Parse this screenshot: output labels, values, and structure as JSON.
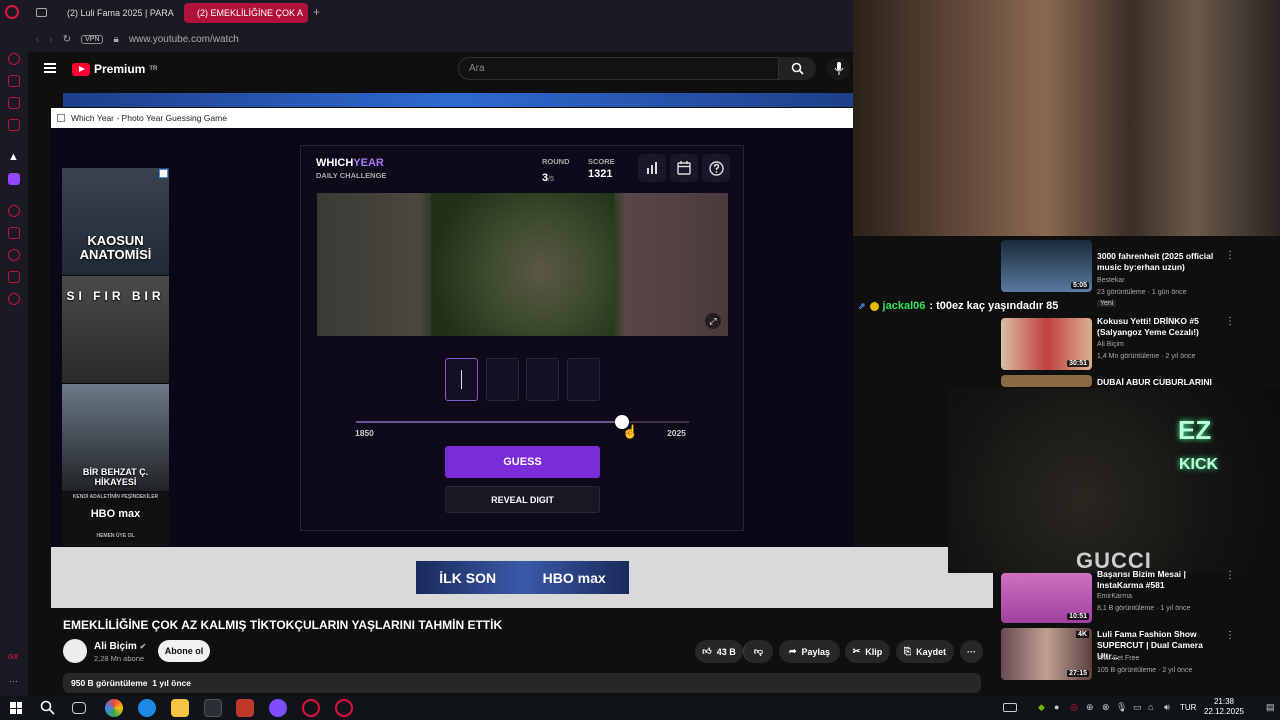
{
  "browser": {
    "tabs": [
      {
        "label": "(2) Luli Fama 2025 | PARA"
      },
      {
        "label": "(2) EMEKLİLİĞİNE ÇOK A"
      }
    ],
    "vpn_label": "VPN",
    "url": "www.youtube.com/watch"
  },
  "youtube": {
    "logo_text": "Premium",
    "logo_sup": "TR",
    "search_placeholder": "Ara"
  },
  "game_window": {
    "title": "Which Year - Photo Year Guessing Game",
    "logo_which": "WHICH",
    "logo_year": "YEAR",
    "logo_sub": "DAILY CHALLENGE",
    "round_label": "ROUND",
    "round_value": "3",
    "round_total": "/5",
    "score_label": "SCORE",
    "score_value": "1321",
    "slider_min": "1850",
    "slider_max": "2025",
    "slider_fraction": 0.8,
    "guess_label": "GUESS",
    "reveal_label": "REVEAL DIGIT",
    "ads": [
      {
        "title": "KAOSUN ANATOMİSİ"
      },
      {
        "title": "SI FIR BIR"
      },
      {
        "title": "BİR BEHZAT Ç. HİKAYESİ"
      },
      {
        "title": "HBO max",
        "tagline": "KENDİ ADALETİNİN PEŞİNDEKİLER",
        "cta": "HEMEN ÜYE OL"
      }
    ],
    "banner_left": "İLK SON",
    "banner_right": "HBO max"
  },
  "video": {
    "title": "EMEKLİLİĞİNE ÇOK AZ KALMIŞ TİKTOKÇULARIN YAŞLARINI TAHMİN ETTİK",
    "channel": "Ali Biçim",
    "subscribers": "2,28 Mn abone",
    "subscribe_label": "Abone ol",
    "likes": "43 B",
    "share_label": "Paylaş",
    "clip_label": "Klip",
    "save_label": "Kaydet",
    "views": "950 B görüntüleme",
    "age": "1 yıl önce"
  },
  "chat": {
    "user": "jackal06",
    "message": ": t00ez kaç yaşındadır 85"
  },
  "recommended": [
    {
      "title": "3000 fahrenheit (2025 official music by:erhan uzun)",
      "channel": "Bestekar",
      "meta": "23 görüntüleme · 1 gün önce",
      "badge": "Yeni",
      "duration": "5:05"
    },
    {
      "title": "Kokusu Yetti! DRİNKO #5 (Salyangoz Yeme Cezalı!)",
      "channel": "Ali Biçim",
      "meta": "1,4 Mn görüntüleme · 2 yıl önce",
      "duration": "30:51"
    },
    {
      "title": "DUBAİ ABUR CUBURLARINI"
    },
    {
      "title": "Başarısı Bizim Mesai | InstaKarma #581",
      "channel": "EmirKarma",
      "meta": "8,1 B görüntüleme · 1 yıl önce",
      "duration": "10:51"
    },
    {
      "title": "Luli Fama Fashion Show SUPERCUT | Dual Camera Ultr...",
      "channel": "Wild Set Free",
      "meta": "105 B görüntüleme · 2 yıl önce",
      "duration": "27:15",
      "badge": "4K"
    }
  ],
  "stream": {
    "overlay_ez": "EZ",
    "overlay_kick": "KICK",
    "shirt_text": "GUCCI"
  },
  "taskbar": {
    "language": "TUR",
    "time": "21:38",
    "date": "22.12.2025"
  }
}
